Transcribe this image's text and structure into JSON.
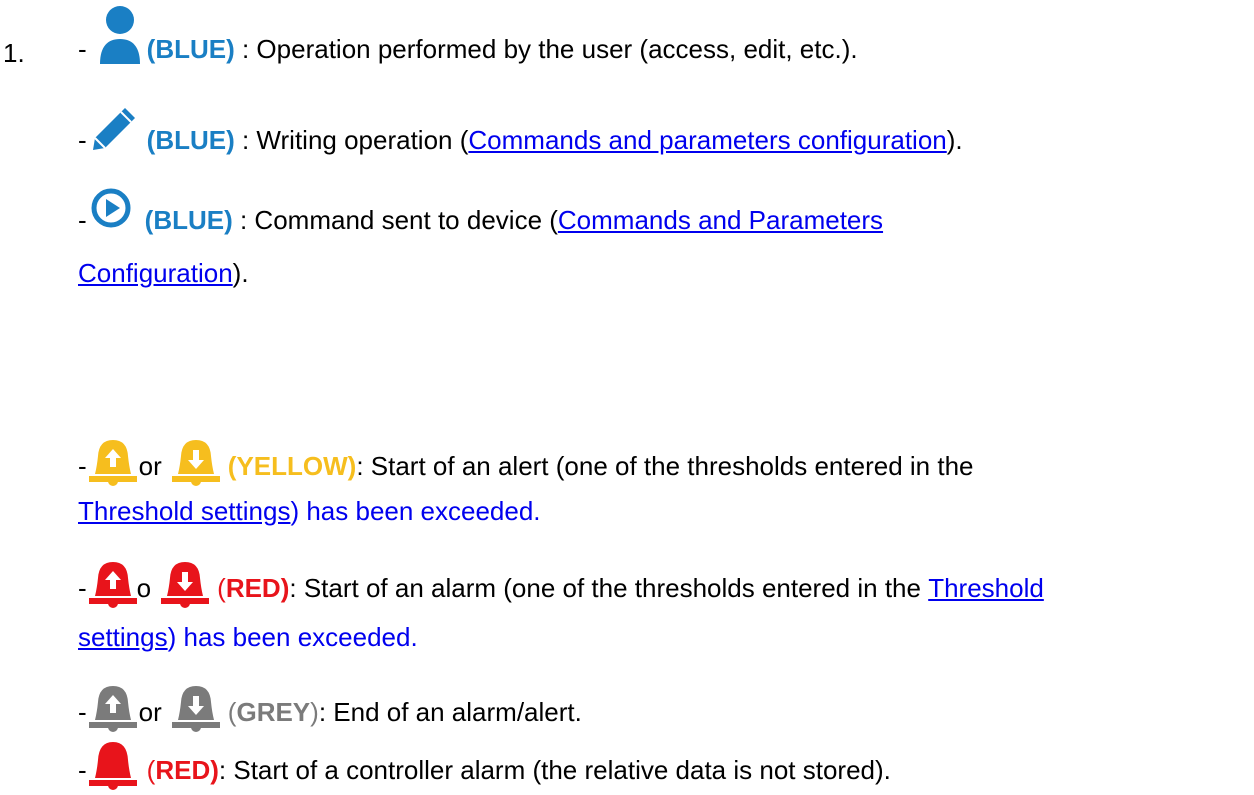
{
  "colors": {
    "blue": "#1a7fc4",
    "yellow": "#f6be1e",
    "red": "#e8141b",
    "grey": "#7b7b7b",
    "link": "#0000ee"
  },
  "list_number": "1.",
  "items": [
    {
      "icon": "user-icon",
      "dash": "-",
      "label": "(BLUE)",
      "text": " : Operation performed by the user (access, edit, etc.)."
    },
    {
      "icon": "pencil-icon",
      "dash": "-",
      "label": "(BLUE)",
      "text_before": " : Writing operation (",
      "link": "Commands and parameters configuration",
      "text_after": ")."
    },
    {
      "icon": "play-circle-icon",
      "dash": "-",
      "label": "(BLUE)",
      "text_before": " : Command sent to device (",
      "link_part1": "Commands and Parameters",
      "link_part2": "Configuration",
      "text_after": ")."
    },
    {
      "icons": [
        "bell-up-icon",
        "bell-down-icon"
      ],
      "dash": "-",
      "connector": "or",
      "label": "(YELLOW)",
      "text": ": Start of an alert (one of the thresholds entered in the",
      "link": "Threshold settings",
      "text_after": ") has been exceeded."
    },
    {
      "icons": [
        "bell-up-icon",
        "bell-down-icon"
      ],
      "dash": "-",
      "connector": "o",
      "label_open": "(",
      "label": "RED)",
      "text": ": Start of an alarm (one of the thresholds entered in the ",
      "link_part1": "Threshold",
      "link_part2": "settings",
      "text_after": ") has been exceeded."
    },
    {
      "icons": [
        "bell-up-icon",
        "bell-down-icon"
      ],
      "dash": "-",
      "connector": "or",
      "label_open": "(",
      "label": "GREY",
      "label_close": ")",
      "text": ": End of an alarm/alert."
    },
    {
      "icon": "bell-icon",
      "dash": "-",
      "label_open": "(",
      "label": "RED)",
      "text": ": Start of a controller alarm (the relative data is not stored)."
    }
  ]
}
